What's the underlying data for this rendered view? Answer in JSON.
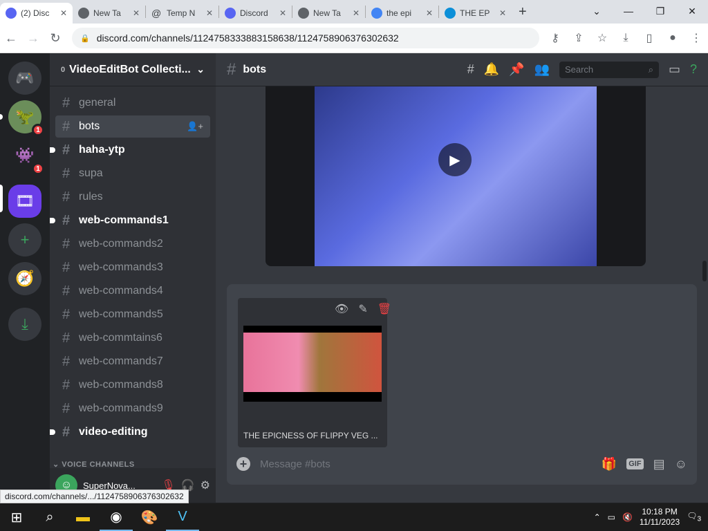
{
  "browser": {
    "tabs": [
      {
        "title": "(2) Disc",
        "icon": "discord-icon"
      },
      {
        "title": "New Ta",
        "icon": "chrome-icon"
      },
      {
        "title": "Temp N",
        "icon": "at-icon"
      },
      {
        "title": "Discord",
        "icon": "discord-icon"
      },
      {
        "title": "New Ta",
        "icon": "chrome-icon"
      },
      {
        "title": "the epi",
        "icon": "google-icon"
      },
      {
        "title": "THE EP",
        "icon": "edge-icon"
      }
    ],
    "url": "discord.com/channels/1124758333883158638/1124758906376302632",
    "status_url": "discord.com/channels/.../1124758906376302632"
  },
  "guild_badges": [
    "1",
    "1"
  ],
  "server": {
    "name": "VideoEditBot Collecti...",
    "prefix": "0"
  },
  "channels": [
    {
      "name": "general"
    },
    {
      "name": "bots"
    },
    {
      "name": "haha-ytp"
    },
    {
      "name": "supa"
    },
    {
      "name": "rules"
    },
    {
      "name": "web-commands1"
    },
    {
      "name": "web-commands2"
    },
    {
      "name": "web-commands3"
    },
    {
      "name": "web-commands4"
    },
    {
      "name": "web-commands5"
    },
    {
      "name": "web-commtains6"
    },
    {
      "name": "web-commands7"
    },
    {
      "name": "web-commands8"
    },
    {
      "name": "web-commands9"
    },
    {
      "name": "video-editing"
    }
  ],
  "voice_category": "VOICE CHANNELS",
  "user": {
    "name": "SuperNova..."
  },
  "main": {
    "channel_name": "bots",
    "search_placeholder": "Search",
    "attachment_name": "THE EPICNESS OF FLIPPY VEG ...",
    "message_placeholder": "Message #bots",
    "gif_label": "GIF"
  },
  "taskbar": {
    "time": "10:18 PM",
    "date": "11/11/2023",
    "notifications": "3"
  },
  "colors": {
    "accent": "#5865f2",
    "danger": "#ed4245",
    "online": "#3ba55d"
  }
}
